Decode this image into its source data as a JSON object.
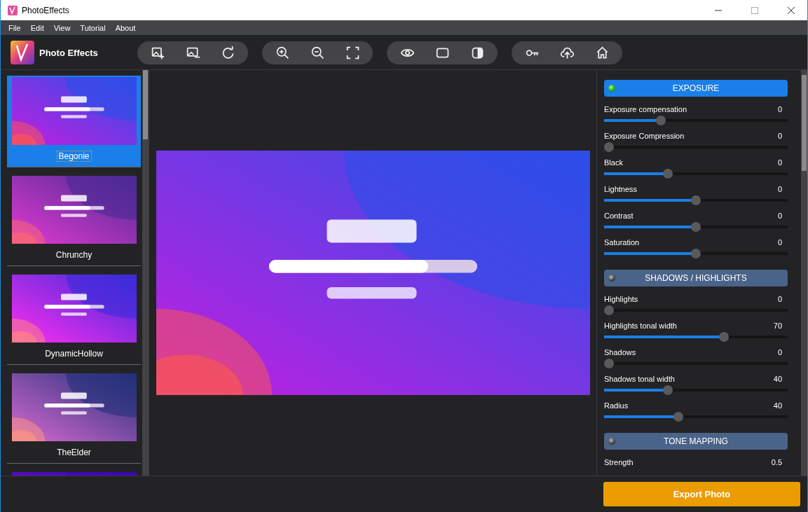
{
  "window": {
    "title": "PhotoEffects"
  },
  "menu": [
    "File",
    "Edit",
    "View",
    "Tutorial",
    "About"
  ],
  "app": {
    "name": "Photo Effects"
  },
  "presets": [
    {
      "name": "Begonie",
      "selected": true
    },
    {
      "name": "Chrunchy",
      "selected": false
    },
    {
      "name": "DynamicHollow",
      "selected": false
    },
    {
      "name": "TheElder",
      "selected": false
    },
    {
      "selected": false
    }
  ],
  "sections": [
    {
      "title": "EXPOSURE",
      "active": true,
      "controls": [
        {
          "label": "Exposure compensation",
          "value": "0",
          "level": 0.3
        },
        {
          "label": "Exposure Compression",
          "value": "0",
          "level": 0
        },
        {
          "label": "Black",
          "value": "0",
          "level": 0.34
        },
        {
          "label": "Lightness",
          "value": "0",
          "level": 0.5
        },
        {
          "label": "Contrast",
          "value": "0",
          "level": 0.5
        },
        {
          "label": "Saturation",
          "value": "0",
          "level": 0.5
        }
      ]
    },
    {
      "title": "SHADOWS / HIGHLIGHTS",
      "active": false,
      "controls": [
        {
          "label": "Highlights",
          "value": "0",
          "level": 0
        },
        {
          "label": "Highlights tonal width",
          "value": "70",
          "level": 0.66
        },
        {
          "label": "Shadows",
          "value": "0",
          "level": 0
        },
        {
          "label": "Shadows tonal width",
          "value": "40",
          "level": 0.34
        },
        {
          "label": "Radius",
          "value": "40",
          "level": 0.4
        }
      ]
    },
    {
      "title": "TONE MAPPING",
      "active": false,
      "controls": [
        {
          "label": "Strength",
          "value": "0.5"
        }
      ]
    }
  ],
  "export_button": "Export Photo"
}
